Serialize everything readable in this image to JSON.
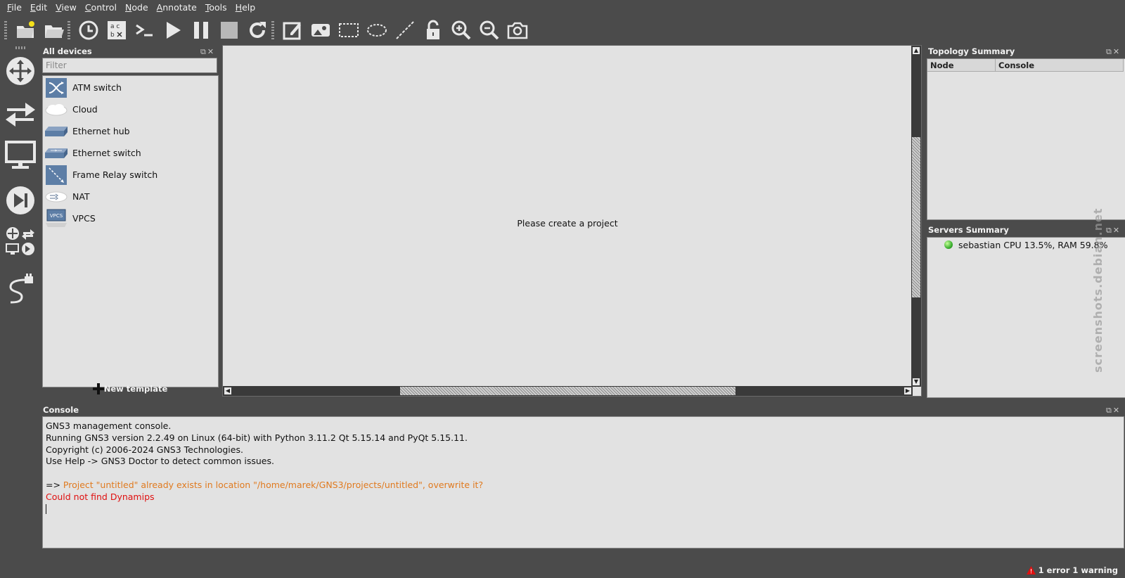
{
  "menubar": [
    "File",
    "Edit",
    "View",
    "Control",
    "Node",
    "Annotate",
    "Tools",
    "Help"
  ],
  "devices": {
    "title": "All devices",
    "filter_placeholder": "Filter",
    "items": [
      {
        "label": "ATM switch",
        "icon": "atm-switch-icon"
      },
      {
        "label": "Cloud",
        "icon": "cloud-icon"
      },
      {
        "label": "Ethernet hub",
        "icon": "ethernet-hub-icon"
      },
      {
        "label": "Ethernet switch",
        "icon": "ethernet-switch-icon"
      },
      {
        "label": "Frame Relay switch",
        "icon": "frame-relay-switch-icon"
      },
      {
        "label": "NAT",
        "icon": "nat-icon"
      },
      {
        "label": "VPCS",
        "icon": "vpcs-icon"
      }
    ],
    "new_template": "New template",
    "vpcs_badge": "VPCS"
  },
  "canvas": {
    "message": "Please create a project"
  },
  "topology": {
    "title": "Topology Summary",
    "col_node": "Node",
    "col_console": "Console"
  },
  "servers": {
    "title": "Servers Summary",
    "entry": "sebastian CPU 13.5%, RAM 59.8%"
  },
  "console": {
    "title": "Console",
    "lines": [
      "GNS3 management console.",
      "Running GNS3 version 2.2.49 on Linux (64-bit) with Python 3.11.2 Qt 5.15.14 and PyQt 5.15.11.",
      "Copyright (c) 2006-2024 GNS3 Technologies.",
      "Use Help -> GNS3 Doctor to detect common issues."
    ],
    "prompt": "=> ",
    "warning": "Project \"untitled\" already exists in location \"/home/marek/GNS3/projects/untitled\", overwrite it?",
    "error": "Could not find Dynamips"
  },
  "status": {
    "text": "1 error 1 warning"
  },
  "watermark": "screenshots.debian.net",
  "colors": {
    "background": "#4b4b4b",
    "panel": "#e2e2e2",
    "warning": "#e07a1f",
    "error": "#e01010"
  }
}
